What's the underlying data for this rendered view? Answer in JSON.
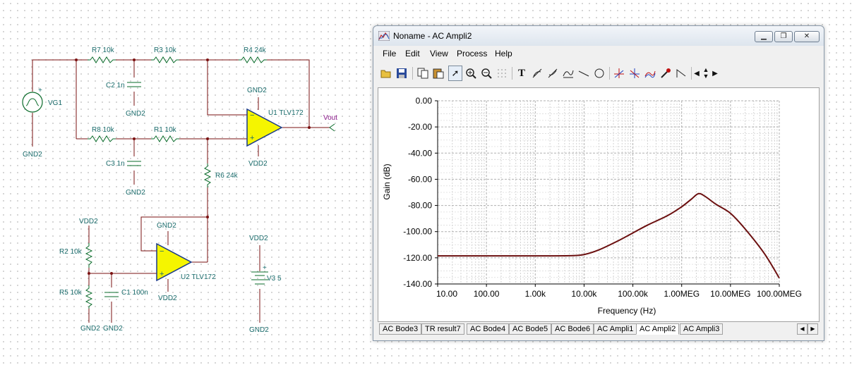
{
  "schematic": {
    "components": {
      "r7": "R7 10k",
      "r3": "R3 10k",
      "r4": "R4 24k",
      "r8": "R8 10k",
      "r1": "R1 10k",
      "r6": "R6 24k",
      "r2": "R2 10k",
      "r5": "R5 10k",
      "c2": "C2 1n",
      "c3": "C3 1n",
      "c1": "C1 100n",
      "vg1": "VG1",
      "u1": "U1 TLV172",
      "u2": "U2 TLV172",
      "v3": "V3 5",
      "vout": "Vout"
    },
    "nets": {
      "gnd": "GND2",
      "vdd": "VDD2"
    }
  },
  "window": {
    "title": "Noname - AC Ampli2",
    "menu": [
      "File",
      "Edit",
      "View",
      "Process",
      "Help"
    ],
    "toolbar_icons": [
      "open-icon",
      "save-icon",
      "copy-icon",
      "paste-icon",
      "pointer-icon",
      "zoom-in-icon",
      "zoom-out-icon",
      "grid-icon",
      "text-icon",
      "cursor-a-icon",
      "cursor-b-icon",
      "curve-icon",
      "line-icon",
      "circle-icon",
      "marker-a-icon",
      "marker-b-icon",
      "wave-icon",
      "probe-icon",
      "ramp-icon",
      "arrow-left-icon",
      "arrow-updown-icon",
      "arrow-right-icon"
    ]
  },
  "chart_data": {
    "type": "line",
    "xlabel": "Frequency (Hz)",
    "ylabel": "Gain (dB)",
    "xscale": "log",
    "xlim": [
      10,
      100000000
    ],
    "ylim": [
      -140,
      0
    ],
    "grid": true,
    "x_ticks": [
      10,
      100,
      1000,
      10000,
      100000,
      1000000,
      10000000,
      100000000
    ],
    "x_tick_labels": [
      "10.00",
      "100.00",
      "1.00k",
      "10.00k",
      "100.00k",
      "1.00MEG",
      "10.00MEG",
      "100.00MEG"
    ],
    "y_ticks": [
      0,
      -20,
      -40,
      -60,
      -80,
      -100,
      -120,
      -140
    ],
    "y_tick_labels": [
      "0.00",
      "-20.00",
      "-40.00",
      "-60.00",
      "-80.00",
      "-100.00",
      "-120.00",
      "-140.00"
    ],
    "series": [
      {
        "color": "#6b0f0f",
        "points": [
          [
            10,
            -118.5
          ],
          [
            100,
            -118.5
          ],
          [
            1000,
            -118.5
          ],
          [
            5000,
            -118.4
          ],
          [
            10000,
            -117.5
          ],
          [
            20000,
            -114
          ],
          [
            50000,
            -107
          ],
          [
            100000,
            -101
          ],
          [
            200000,
            -95
          ],
          [
            500000,
            -88
          ],
          [
            1000000,
            -81
          ],
          [
            1600000,
            -75
          ],
          [
            2200000,
            -71
          ],
          [
            3000000,
            -73
          ],
          [
            5000000,
            -79
          ],
          [
            10000000,
            -86
          ],
          [
            20000000,
            -98
          ],
          [
            50000000,
            -117
          ],
          [
            100000000,
            -135.5
          ]
        ]
      }
    ]
  },
  "tabs": {
    "items": [
      "AC Bode3",
      "TR result7",
      "AC Bode4",
      "AC Bode5",
      "AC Bode6",
      "AC Ampli1",
      "AC Ampli2",
      "AC Ampli3"
    ],
    "active": "AC Ampli2",
    "scroll_left": "◀",
    "scroll_right": "▶"
  }
}
